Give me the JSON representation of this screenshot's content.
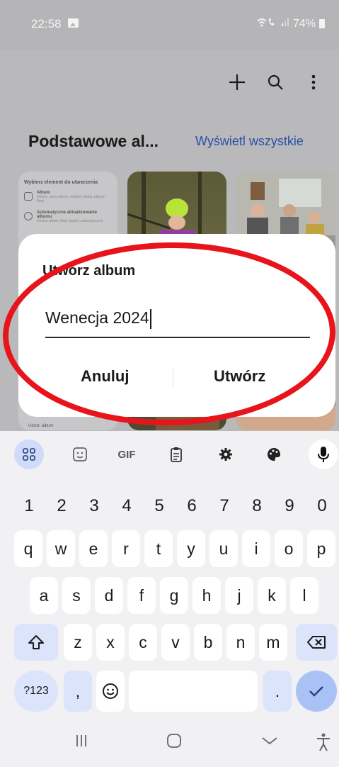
{
  "status_bar": {
    "time": "22:58",
    "battery": "74%"
  },
  "section": {
    "title": "Podstawowe al...",
    "view_all": "Wyświetl wszystkie"
  },
  "card_preview": {
    "heading": "Wybierz element do utworzenia",
    "item1_title": "Album",
    "item1_sub": "Utwórz nowy album i wybierz dodaj zdjęcia i filmy.",
    "item2_title": "Automatyczne aktualizowanie albumu",
    "item2_sub": "Utwórz album, który będzie automatycznie",
    "item3_title": "Udost. album"
  },
  "dialog": {
    "title": "Utwórz album",
    "input_value": "Wenecja 2024",
    "cancel_label": "Anuluj",
    "create_label": "Utwórz"
  },
  "keyboard": {
    "toolbar": [
      "emoji-grid-icon",
      "sticker-icon",
      "GIF",
      "clipboard-icon",
      "settings-icon",
      "palette-icon",
      "mic-icon"
    ],
    "gif_label": "GIF",
    "row_numbers": [
      "1",
      "2",
      "3",
      "4",
      "5",
      "6",
      "7",
      "8",
      "9",
      "0"
    ],
    "row1": [
      "q",
      "w",
      "e",
      "r",
      "t",
      "y",
      "u",
      "i",
      "o",
      "p"
    ],
    "row2": [
      "a",
      "s",
      "d",
      "f",
      "g",
      "h",
      "j",
      "k",
      "l"
    ],
    "row3": [
      "z",
      "x",
      "c",
      "v",
      "b",
      "n",
      "m"
    ],
    "sym_label": "?123",
    "comma": ",",
    "period": "."
  },
  "colors": {
    "accent": "#2a4fa7",
    "annotation": "#e8141b",
    "enter_key": "#a9c2f5"
  }
}
